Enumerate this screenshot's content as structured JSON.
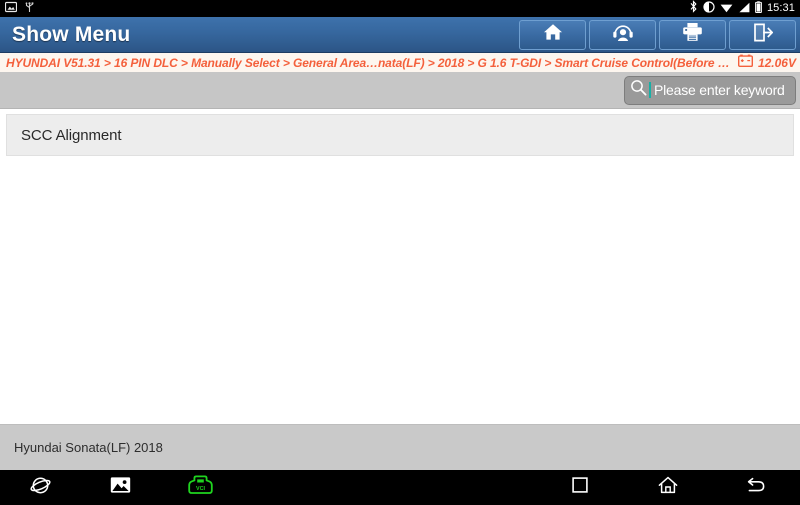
{
  "status_bar": {
    "icons_left": [
      "screenshot-icon",
      "usb-icon"
    ],
    "icons_right": [
      "bluetooth-icon",
      "dnd-icon",
      "wifi-icon",
      "signal-icon",
      "battery-icon"
    ],
    "clock": "15:31"
  },
  "title_bar": {
    "title": "Show Menu",
    "buttons": [
      {
        "name": "home-button",
        "icon": "home-icon"
      },
      {
        "name": "support-button",
        "icon": "headset-icon"
      },
      {
        "name": "print-button",
        "icon": "printer-icon"
      },
      {
        "name": "exit-button",
        "icon": "exit-icon"
      }
    ]
  },
  "breadcrumb": {
    "path": "HYUNDAI V51.31 > 16 PIN DLC > Manually Select > General Area…nata(LF) > 2018 > G 1.6 T-GDI > Smart Cruise Control(Before FL)",
    "battery_icon": "car-battery-icon",
    "voltage": "12.06V"
  },
  "search": {
    "icon": "search-icon",
    "placeholder": "Please enter keyword",
    "value": ""
  },
  "main": {
    "items": [
      {
        "label": "SCC Alignment"
      }
    ]
  },
  "footer": {
    "vehicle": "Hyundai Sonata(LF) 2018"
  },
  "nav_bar": {
    "left": [
      "browser-icon",
      "gallery-icon",
      "vci-icon"
    ],
    "right": [
      "recents-icon",
      "home-icon",
      "back-icon"
    ]
  },
  "colors": {
    "header_blue": "#36679e",
    "breadcrumb_orange": "#f4603c",
    "vci_green": "#1fd51f",
    "caret_teal": "#17b0a6",
    "footer_gray": "#c9c9c9"
  }
}
